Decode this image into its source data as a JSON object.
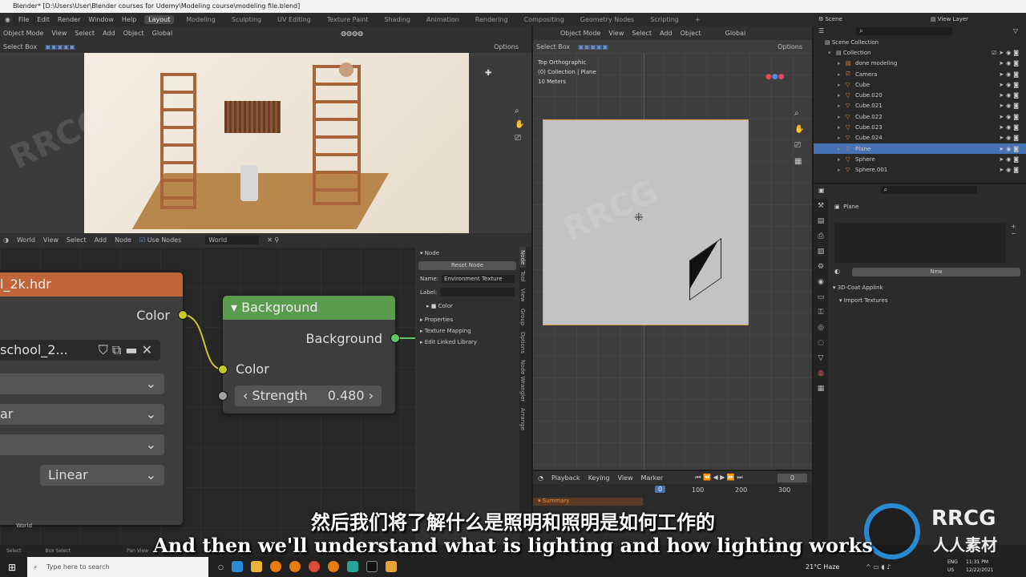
{
  "window": {
    "title": "Blender* [D:\\Users\\User\\Blender courses for Udemy\\Modeling course\\modeling file.blend]"
  },
  "menu": [
    "File",
    "Edit",
    "Render",
    "Window",
    "Help"
  ],
  "workspaces": [
    "Layout",
    "Modeling",
    "Sculpting",
    "UV Editing",
    "Texture Paint",
    "Shading",
    "Animation",
    "Rendering",
    "Compositing",
    "Geometry Nodes",
    "Scripting",
    "+"
  ],
  "viewport_left": {
    "mode": "Object Mode",
    "menus": [
      "View",
      "Select",
      "Add",
      "Object"
    ],
    "orientation": "Global",
    "select_box": "Select Box",
    "options": "Options"
  },
  "viewport_right": {
    "mode": "Object Mode",
    "menus": [
      "View",
      "Select",
      "Add",
      "Object"
    ],
    "orientation": "Global",
    "select_box": "Select Box",
    "options": "Options",
    "overlay_lines": [
      "Top Orthographic",
      "(0) Collection | Plane",
      "10 Meters"
    ]
  },
  "node_editor": {
    "world_type": "World",
    "menus": [
      "View",
      "Select",
      "Add",
      "Node"
    ],
    "use_nodes": "Use Nodes",
    "world_name": "World",
    "footer_label": "World",
    "env_node": {
      "title": "l_2k.hdr",
      "output": "Color",
      "image": "school_2...",
      "dropdown1": "",
      "dropdown2": "ar",
      "dropdown3": "",
      "dropdown4": "Linear"
    },
    "bg_node": {
      "title": "Background",
      "output": "Background",
      "input_color": "Color",
      "strength_label": "Strength",
      "strength_value": "0.480"
    }
  },
  "n_panel": {
    "section": "Node",
    "reset": "Reset Node",
    "name_label": "Name:",
    "name_value": "Environment Texture",
    "label_label": "Label:",
    "color": "Color",
    "subsections": [
      "Properties",
      "Texture Mapping",
      "Edit Linked Library"
    ],
    "tabs": [
      "Node",
      "Tool",
      "View",
      "Group",
      "Options",
      "Node Wrangler",
      "Arrange"
    ]
  },
  "timeline": {
    "menus": [
      "Playback",
      "Keying",
      "View",
      "Marker"
    ],
    "current_frame": "0",
    "frame_marker": "0",
    "ticks": [
      "100",
      "200",
      "300"
    ],
    "summary": "Summary"
  },
  "outliner": {
    "scene": "Scene",
    "view_layer": "View Layer",
    "scene_collection": "Scene Collection",
    "collection": "Collection",
    "items": [
      {
        "name": "done modeling",
        "type": "collection"
      },
      {
        "name": "Camera",
        "type": "camera"
      },
      {
        "name": "Cube",
        "type": "mesh"
      },
      {
        "name": "Cube.020",
        "type": "mesh"
      },
      {
        "name": "Cube.021",
        "type": "mesh"
      },
      {
        "name": "Cube.022",
        "type": "mesh"
      },
      {
        "name": "Cube.023",
        "type": "mesh"
      },
      {
        "name": "Cube.024",
        "type": "mesh"
      },
      {
        "name": "Plane",
        "type": "mesh",
        "selected": true
      },
      {
        "name": "Sphere",
        "type": "mesh"
      },
      {
        "name": "Sphere.001",
        "type": "mesh"
      }
    ]
  },
  "properties": {
    "object": "Plane",
    "new": "New",
    "panel1": "3D-Coat Applink",
    "panel2": "Import Textures"
  },
  "statusbar": {
    "items": [
      "Select",
      "Box Select",
      "Pan View"
    ]
  },
  "taskbar": {
    "search_placeholder": "Type here to search",
    "weather": "21°C Haze",
    "lang1": "ENG",
    "lang2": "US",
    "time": "11:31 PM",
    "date": "12/22/2021"
  },
  "subtitles": {
    "zh": "然后我们将了解什么是照明和照明是如何工作的",
    "en": "And then we'll understand what is lighting and how lighting works"
  },
  "watermark": {
    "brand": "RRCG",
    "cn": "人人素材"
  },
  "colors": {
    "accent": "#4772b3",
    "env_header": "#c0643a",
    "bg_header": "#5c9b4f",
    "socket_yellow": "#c7c729",
    "socket_green": "#63c763"
  }
}
